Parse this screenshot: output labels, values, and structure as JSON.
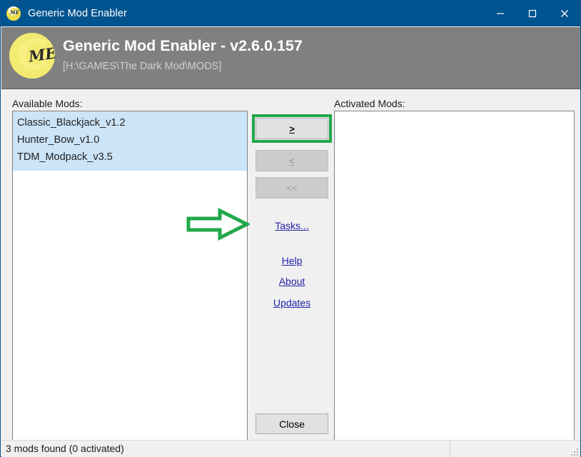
{
  "window": {
    "title": "Generic Mod Enabler",
    "icon": "gme-logo-icon",
    "controls": {
      "minimize": "minimize-icon",
      "maximize": "maximize-icon",
      "close": "close-icon"
    }
  },
  "header": {
    "logo_g": "G",
    "logo_me": "ME",
    "title": "Generic Mod Enabler - v2.6.0.157",
    "path": "[H:\\GAMES\\The Dark Mod\\MODS]"
  },
  "available": {
    "label": "Available Mods:",
    "items": [
      "Classic_Blackjack_v1.2",
      "Hunter_Bow_v1.0",
      "TDM_Modpack_v3.5"
    ]
  },
  "activated": {
    "label": "Activated Mods:",
    "items": []
  },
  "center": {
    "add_label": ">",
    "remove_label": "<",
    "remove_all_label": "<<",
    "tasks_label": "Tasks...",
    "help_label": "Help",
    "about_label": "About",
    "updates_label": "Updates",
    "close_label": "Close"
  },
  "annotation": {
    "arrow": "right-arrow-annotation",
    "highlight_target": "add-mod-button",
    "color": "#22a84a"
  },
  "status": {
    "text": "3 mods found (0 activated)"
  },
  "colors": {
    "titlebar": "#00548f",
    "header_band": "#808080",
    "dialog_face": "#f0f0f0",
    "selection": "#cce4f7",
    "link": "#2222aa",
    "annotation_green": "#22a84a"
  }
}
